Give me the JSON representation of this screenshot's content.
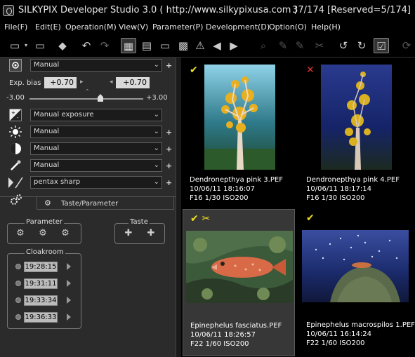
{
  "window": {
    "title": "SILKYPIX Developer Studio 3.0 ( http://www.silkypixusa.com )",
    "counter": "37/174 [Reserved=5/174]"
  },
  "menu": [
    "File(F)",
    "Edit(E)",
    "Operation(M)",
    "View(V)",
    "Parameter(P)",
    "Development(D)",
    "Option(O)",
    "Help(H)"
  ],
  "panel": {
    "white_balance_preset": "Manual",
    "exp_bias_label": "Exp. bias",
    "exp_bias_value": "+0.70",
    "exp_bias_value2": "+0.70",
    "exp_min": "-3.00",
    "exp_max": "+3.00",
    "exposure_mode": "Manual exposure",
    "row3": "Manual",
    "row4": "Manual",
    "row5": "Manual",
    "sharpness": "pentax sharp",
    "taste_tab": "Taste/Parameter",
    "parameter_group": "Parameter",
    "taste_group": "Taste",
    "cloakroom_group": "Cloakroom",
    "cloakroom_times": [
      "19:28:15",
      "19:31:11",
      "19:33:34",
      "19:36:33"
    ]
  },
  "thumbnails": [
    {
      "name": "Dendronepthya pink 3.PEF",
      "date": "10/06/11 18:16:07",
      "exif": "F16 1/30 ISO200",
      "mark": "✔"
    },
    {
      "name": "Dendronepthya pink 4.PEF",
      "date": "10/06/11 18:17:14",
      "exif": "F16 1/30 ISO200",
      "mark": "✕"
    },
    {
      "name": "Epinephelus fasciatus.PEF",
      "date": "10/06/11 18:26:57",
      "exif": "F22 1/60 ISO200",
      "mark": "✔ ✂"
    },
    {
      "name": "Epinephelus macrospilos 1.PEF",
      "date": "10/06/11 16:14:24",
      "exif": "F22 1/60 ISO200",
      "mark": "✔"
    }
  ],
  "colors": {
    "ok_mark": "#f0e020",
    "reject_mark": "#e03030",
    "panel_bg": "#2b2b2b"
  }
}
